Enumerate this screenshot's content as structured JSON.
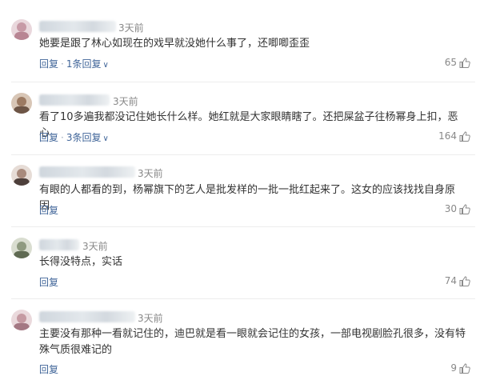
{
  "comments": [
    {
      "time": "3天前",
      "text": "她要是跟了林心如现在的戏早就没她什么事了，还唧唧歪歪",
      "reply_label": "回复",
      "more_replies": "1条回复",
      "likes": "65"
    },
    {
      "time": "3天前",
      "text": "看了10多遍我都没记住她长什么样。她红就是大家眼睛瞎了。还把屎盆子往杨幂身上扣，恶心",
      "reply_label": "回复",
      "more_replies": "3条回复",
      "likes": "164"
    },
    {
      "time": "3天前",
      "text": "有眼的人都看的到，杨幂旗下的艺人是批发样的一批一批红起来了。这女的应该找找自身原因",
      "reply_label": "回复",
      "likes": "30"
    },
    {
      "time": "3天前",
      "text": "长得没特点，实话",
      "reply_label": "回复",
      "likes": "74"
    },
    {
      "time": "3天前",
      "text": "主要没有那种一看就记住的，迪巴就是看一眼就会记住的女孩，一部电视剧脸孔很多，没有特殊气质很难记的",
      "reply_label": "回复",
      "likes": "9"
    }
  ],
  "colors": {
    "link": "#406599",
    "muted": "#888888",
    "text": "#333333"
  },
  "icons": {
    "like": "thumbs-up-icon",
    "expand": "chevron-down-icon"
  }
}
